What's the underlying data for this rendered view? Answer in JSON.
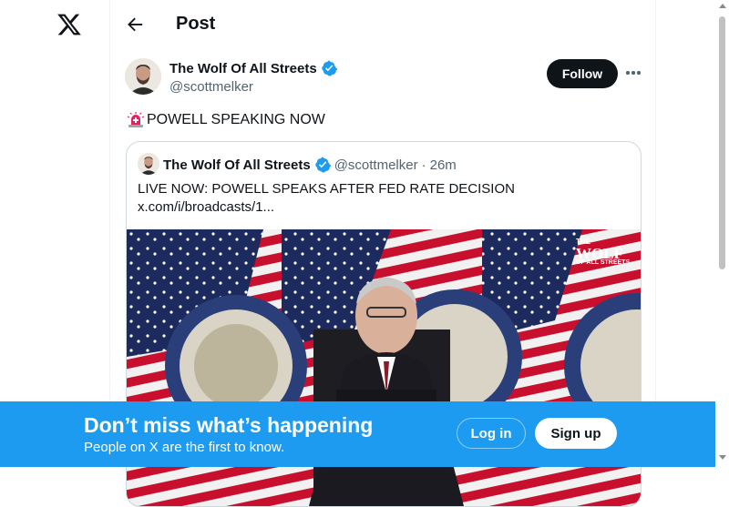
{
  "app": {
    "logo_icon": "x-logo-icon",
    "header": {
      "title": "Post",
      "back_icon": "arrow-left-icon"
    }
  },
  "post": {
    "author": {
      "name": "The Wolf Of All Streets",
      "handle": "@scottmelker",
      "verified": true
    },
    "follow_label": "Follow",
    "more_icon": "more-horizontal-icon",
    "siren_icon": "police-light-icon",
    "text": "POWELL SPEAKING NOW"
  },
  "quote": {
    "author": {
      "name": "The Wolf Of All Streets",
      "handle": "@scottmelker",
      "verified": true
    },
    "separator": "·",
    "time": "26m",
    "text_line1": "LIVE NOW: POWELL SPEAKS AFTER FED RATE DECISION",
    "text_line2": "x.com/i/broadcasts/1...",
    "media": {
      "watermark_line1": "THE",
      "watermark_line2": "WOLF",
      "watermark_line3": "OF ALL STREETS"
    }
  },
  "banner": {
    "title": "Don’t miss what’s happening",
    "subtitle": "People on X are the first to know.",
    "login_label": "Log in",
    "signup_label": "Sign up"
  },
  "colors": {
    "accent": "#1d9bf0",
    "text": "#0f1419",
    "muted": "#536471",
    "border": "#eff3f4"
  }
}
